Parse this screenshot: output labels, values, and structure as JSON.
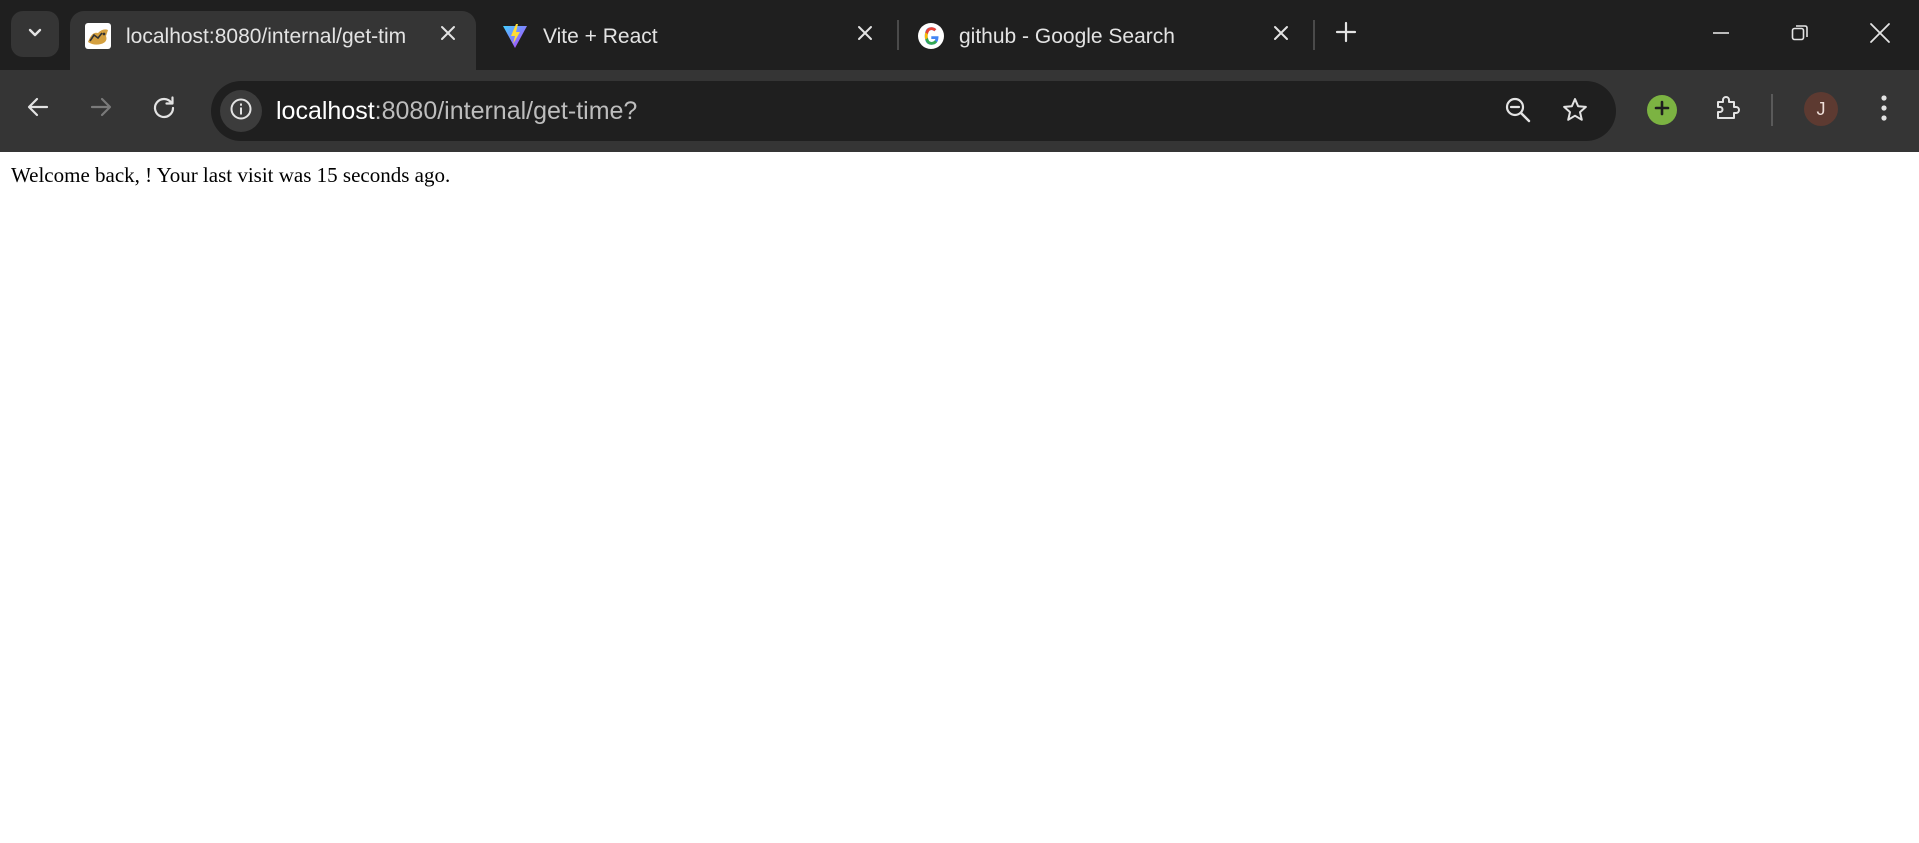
{
  "browser": {
    "tabs": [
      {
        "title": "localhost:8080/internal/get-tim",
        "active": true,
        "favicon": "tomcat-icon"
      },
      {
        "title": "Vite + React",
        "active": false,
        "favicon": "vite-icon"
      },
      {
        "title": "github - Google Search",
        "active": false,
        "favicon": "google-icon"
      }
    ],
    "address_bar": {
      "host": "localhost",
      "path": ":8080/internal/get-time?"
    },
    "profile_initial": "J",
    "colors": {
      "chrome_background": "#1f1f1f",
      "toolbar_background": "#353535",
      "extension_green": "#7cb342",
      "avatar_background": "#5d3a31"
    }
  },
  "page": {
    "message": "Welcome back, ! Your last visit was 15 seconds ago."
  }
}
